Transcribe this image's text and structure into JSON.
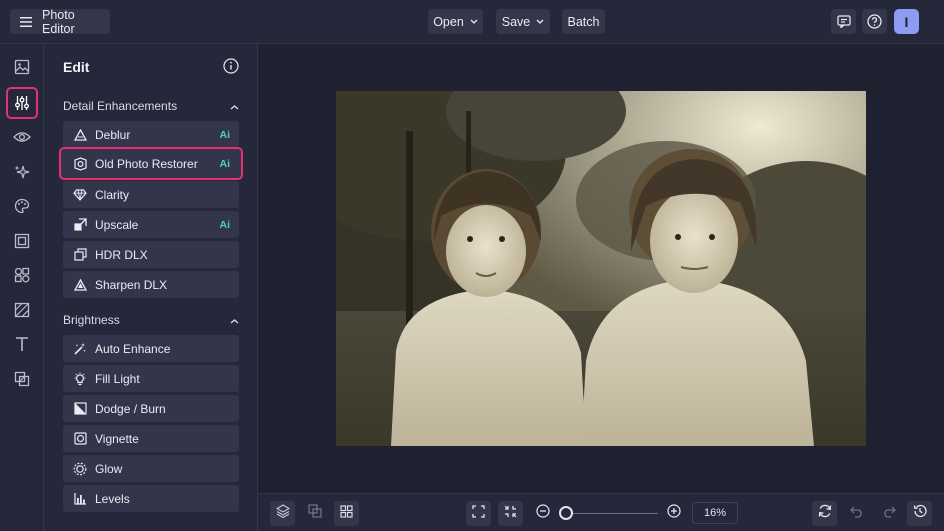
{
  "header": {
    "menu_icon": "hamburger-icon",
    "app_title": "Photo Editor",
    "open_label": "Open",
    "save_label": "Save",
    "batch_label": "Batch",
    "feedback_icon": "chat-icon",
    "help_icon": "help-icon",
    "avatar_initial": "I"
  },
  "rail": [
    "image-icon",
    "sliders-icon",
    "eye-icon",
    "sparkles-icon",
    "palette-icon",
    "frame-icon",
    "shapes-icon",
    "texture-icon",
    "text-icon",
    "graphics-icon"
  ],
  "panel": {
    "title": "Edit",
    "sections": [
      {
        "label": "Detail Enhancements",
        "tools": [
          {
            "label": "Deblur",
            "badge": "Ai",
            "icon": "triangle-icon"
          },
          {
            "label": "Old Photo Restorer",
            "badge": "Ai",
            "icon": "restorer-icon"
          },
          {
            "label": "Clarity",
            "badge": "",
            "icon": "diamond-icon"
          },
          {
            "label": "Upscale",
            "badge": "Ai",
            "icon": "upscale-icon"
          },
          {
            "label": "HDR DLX",
            "badge": "",
            "icon": "hdr-icon"
          },
          {
            "label": "Sharpen DLX",
            "badge": "",
            "icon": "sharpen-icon"
          }
        ]
      },
      {
        "label": "Brightness",
        "tools": [
          {
            "label": "Auto Enhance",
            "badge": "",
            "icon": "magic-wand-icon"
          },
          {
            "label": "Fill Light",
            "badge": "",
            "icon": "bulb-icon"
          },
          {
            "label": "Dodge / Burn",
            "badge": "",
            "icon": "dodge-burn-icon"
          },
          {
            "label": "Vignette",
            "badge": "",
            "icon": "vignette-icon"
          },
          {
            "label": "Glow",
            "badge": "",
            "icon": "glow-icon"
          },
          {
            "label": "Levels",
            "badge": "",
            "icon": "levels-icon"
          }
        ]
      }
    ]
  },
  "bottom": {
    "zoom_value": "16%",
    "zoom_level": 0.16
  },
  "colors": {
    "highlight": "#e0336f",
    "ai_badge": "#4fd1b4",
    "avatar": "#8d9bf0"
  }
}
